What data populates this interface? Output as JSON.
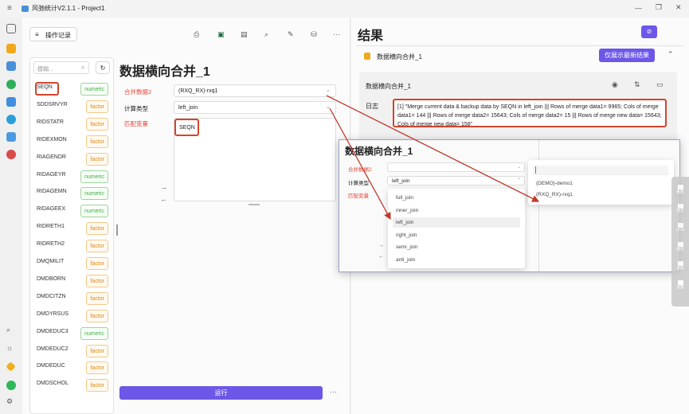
{
  "app": {
    "title": "风弛统计V2.1.1 - Project1"
  },
  "left": {
    "history_button": "操作记录",
    "search_placeholder": "模糊...",
    "variables": [
      {
        "name": "SEQN",
        "type": "numeric"
      },
      {
        "name": "SDDSRVYR",
        "type": "factor"
      },
      {
        "name": "RIDSTATR",
        "type": "factor"
      },
      {
        "name": "RIDEXMON",
        "type": "factor"
      },
      {
        "name": "RIAGENDR",
        "type": "factor"
      },
      {
        "name": "RIDAGEYR",
        "type": "numeric"
      },
      {
        "name": "RIDAGEMN",
        "type": "numeric"
      },
      {
        "name": "RIDAGEEX",
        "type": "numeric"
      },
      {
        "name": "RIDRETH1",
        "type": "factor"
      },
      {
        "name": "RIDRETH2",
        "type": "factor"
      },
      {
        "name": "DMQMILIT",
        "type": "factor"
      },
      {
        "name": "DMDBORN",
        "type": "factor"
      },
      {
        "name": "DMDCITZN",
        "type": "factor"
      },
      {
        "name": "DMDYRSUS",
        "type": "factor"
      },
      {
        "name": "DMDEDUC3",
        "type": "numeric"
      },
      {
        "name": "DMDEDUC2",
        "type": "factor"
      },
      {
        "name": "DMDEDUC",
        "type": "factor"
      },
      {
        "name": "DMDSCHOL",
        "type": "factor"
      }
    ],
    "panel_title": "数据横向合并_1",
    "merge_data2_label": "合并数据2",
    "merge_data2_value": "(RXQ_RX)-rxq1",
    "calc_type_label": "计算类型",
    "calc_type_value": "left_join",
    "match_var_label": "匹配变量",
    "match_var_value": "SEQN",
    "run_button": "运行",
    "more": "···"
  },
  "right": {
    "heading": "结果",
    "result_title": "数据横向合并_1",
    "latest_button": "仅展示最新结果",
    "card_title": "数据横向合并_1",
    "log_label": "日志",
    "log_text": "[1] \"Merge current data & backup data by SEQN in left_join ||| Rows of merge data1= 9965; Cols of merge data1= 144 ||| Rows of merge data2= 15643; Cols of merge data2= 15 ||| Rows of merge new data= 15643; Cols of merge new data= 158\""
  },
  "zoom": {
    "title": "数据横向合并_1",
    "merge_data2_label": "合并数据2",
    "calc_type_label": "计算类型",
    "calc_type_value": "left_join",
    "match_var_label": "匹配变量",
    "join_options": [
      "full_join",
      "inner_join",
      "left_join",
      "right_join",
      "semi_join",
      "anti_join"
    ],
    "data_options": [
      "(DEMO)-demo1",
      "(RXQ_RX)-rxq1"
    ]
  },
  "side_tools": [
    "截图",
    "放大",
    "OCR",
    "翻译",
    "录屏",
    "设置"
  ]
}
